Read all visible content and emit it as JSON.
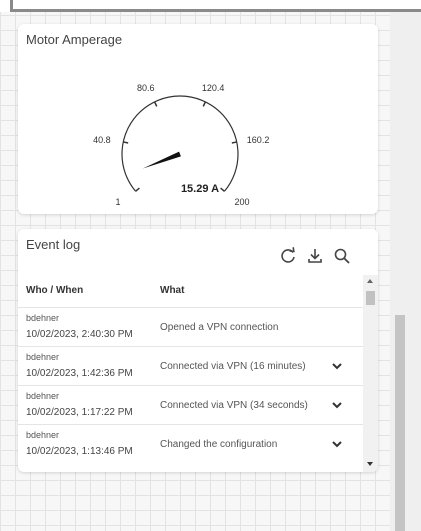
{
  "gauge": {
    "title": "Motor Amperage",
    "value": 15.29,
    "display": "15.29 A",
    "min": 1,
    "max": 200,
    "ticks": [
      "1",
      "40.8",
      "80.6",
      "120.4",
      "160.2",
      "200"
    ]
  },
  "event_log": {
    "title": "Event log",
    "toolbar": {
      "refresh_icon": "refresh-icon",
      "download_icon": "download-icon",
      "search_icon": "search-icon"
    },
    "columns": [
      "Who / When",
      "What"
    ],
    "rows": [
      {
        "who": "bdehner",
        "when": "10/02/2023, 2:40:30 PM",
        "what": "Opened a VPN connection",
        "expandable": false
      },
      {
        "who": "bdehner",
        "when": "10/02/2023, 1:42:36 PM",
        "what": "Connected via VPN (16 minutes)",
        "expandable": true
      },
      {
        "who": "bdehner",
        "when": "10/02/2023, 1:17:22 PM",
        "what": "Connected via VPN (34 seconds)",
        "expandable": true
      },
      {
        "who": "bdehner",
        "when": "10/02/2023, 1:13:46 PM",
        "what": "Changed the configuration",
        "expandable": true
      }
    ]
  }
}
